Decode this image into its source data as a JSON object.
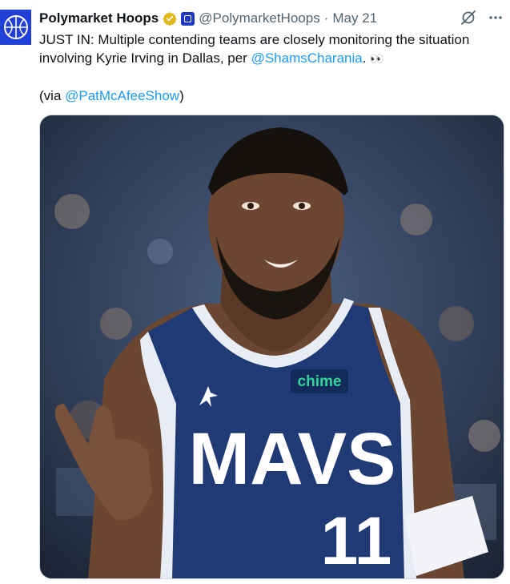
{
  "tweet": {
    "author_name": "Polymarket Hoops",
    "handle": "@PolymarketHoops",
    "separator": "·",
    "date": "May 21",
    "line1_prefix": "JUST IN: Multiple contending teams are closely monitoring the situation involving Kyrie Irving in Dallas, per ",
    "mention1": "@ShamsCharania",
    "line1_suffix": ". ",
    "eyes": "👀",
    "via_prefix": "(via ",
    "mention2": "@PatMcAfeeShow",
    "via_suffix": ")"
  },
  "photo": {
    "jersey_sponsor": "chime",
    "jersey_word": "MAVS",
    "jersey_number": "11"
  },
  "colors": {
    "accent": "#1d9bf0",
    "avatar_bg": "#1f3fd6",
    "jersey": "#1f3a75"
  },
  "icons": {
    "verified": "gold-verified-badge",
    "affiliate": "affiliate-badge",
    "grok": "grok-icon",
    "more": "more-icon"
  }
}
